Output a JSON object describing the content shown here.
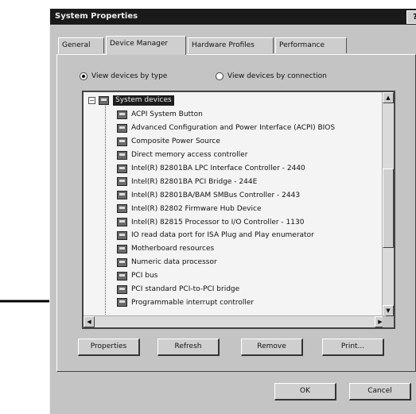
{
  "window": {
    "title": "System Properties",
    "help_label": "?"
  },
  "tabs": [
    {
      "label": "General"
    },
    {
      "label": "Device Manager"
    },
    {
      "label": "Hardware Profiles"
    },
    {
      "label": "Performance"
    }
  ],
  "view_options": {
    "by_type_label": "View devices by type",
    "by_connection_label": "View devices by connection",
    "selected": "by_type"
  },
  "tree": {
    "root_label": "System devices",
    "expander": "−",
    "children": [
      "ACPI System Button",
      "Advanced Configuration and Power Interface (ACPI) BIOS",
      "Composite Power Source",
      "Direct memory access controller",
      "Intel(R) 82801BA LPC Interface Controller - 2440",
      "Intel(R) 82801BA PCI Bridge - 244E",
      "Intel(R) 82801BA/BAM SMBus Controller - 2443",
      "Intel(R) 82802 Firmware Hub Device",
      "Intel(R) 82815 Processor to I/O Controller - 1130",
      "IO read data port for ISA Plug and Play enumerator",
      "Motherboard resources",
      "Numeric data processor",
      "PCI bus",
      "PCI standard PCI-to-PCI bridge",
      "Programmable interrupt controller"
    ]
  },
  "scroll": {
    "up": "▲",
    "down": "▼",
    "left": "◀",
    "right": "▶"
  },
  "buttons": {
    "properties": "Properties",
    "refresh": "Refresh",
    "remove": "Remove",
    "print": "Print...",
    "ok": "OK",
    "cancel": "Cancel"
  }
}
